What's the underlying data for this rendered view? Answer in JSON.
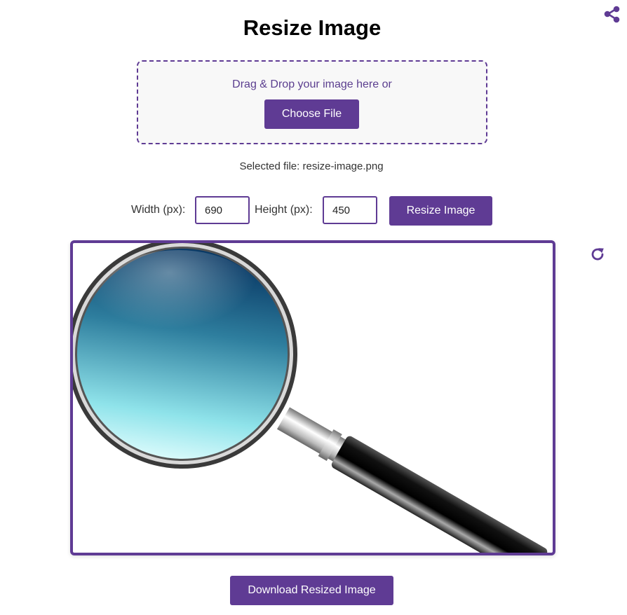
{
  "page": {
    "title": "Resize Image"
  },
  "upload": {
    "drop_text": "Drag & Drop your image here or",
    "choose_label": "Choose File",
    "selected_prefix": "Selected file:",
    "selected_file": "resize-image.png"
  },
  "dimensions": {
    "width_label": "Width (px):",
    "width_value": "690",
    "height_label": "Height (px):",
    "height_value": "450",
    "resize_label": "Resize Image"
  },
  "actions": {
    "download_label": "Download Resized Image"
  },
  "icons": {
    "share": "share-icon",
    "reset": "refresh-icon"
  },
  "colors": {
    "accent": "#5f3b94"
  }
}
